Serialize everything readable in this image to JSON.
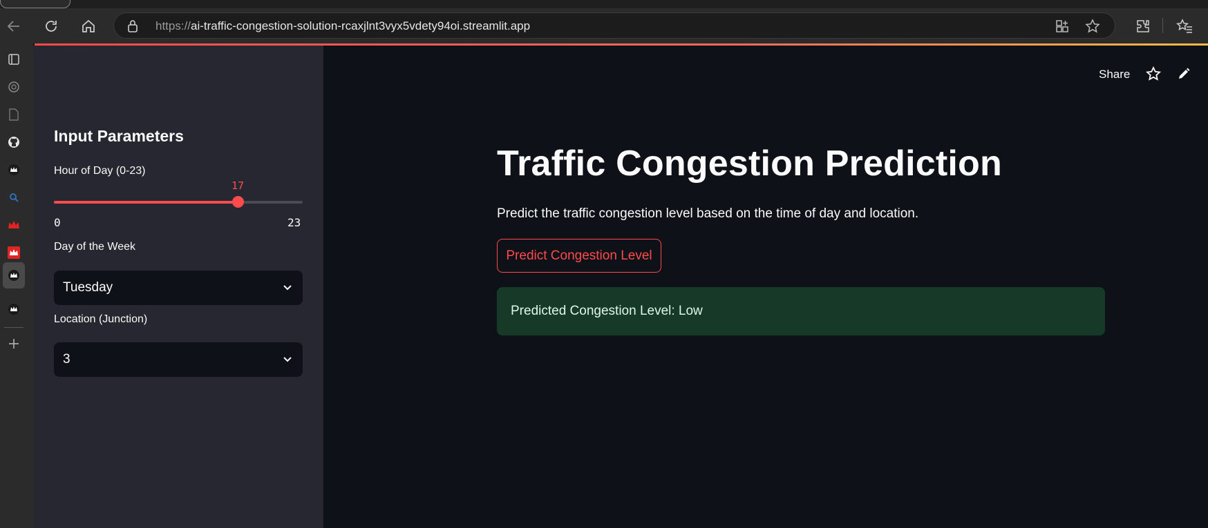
{
  "browser": {
    "url_scheme": "https://",
    "url_host": "ai-traffic-congestion-solution-rcaxjlnt3vyx5vdety94oi.streamlit.app",
    "icons": [
      "back-icon",
      "reload-icon",
      "home-icon",
      "lock-icon",
      "app-available-icon",
      "favorite-star-icon",
      "extensions-icon",
      "favorites-icon"
    ]
  },
  "sidebar": {
    "title": "Input Parameters",
    "hour": {
      "label": "Hour of Day (0-23)",
      "value": 17,
      "value_text": "17",
      "min": 0,
      "max": 23,
      "min_text": "0",
      "max_text": "23"
    },
    "day": {
      "label": "Day of the Week",
      "value": "Tuesday"
    },
    "location": {
      "label": "Location (Junction)",
      "value": "3"
    }
  },
  "header": {
    "share_label": "Share"
  },
  "main": {
    "title": "Traffic Congestion Prediction",
    "description": "Predict the traffic congestion level based on the time of day and location.",
    "button_label": "Predict Congestion Level",
    "result_text": "Predicted Congestion Level: Low"
  },
  "colors": {
    "accent": "#ff4b4b",
    "background": "#0e1117",
    "sidebar": "#262730",
    "success_bg": "#173928"
  }
}
